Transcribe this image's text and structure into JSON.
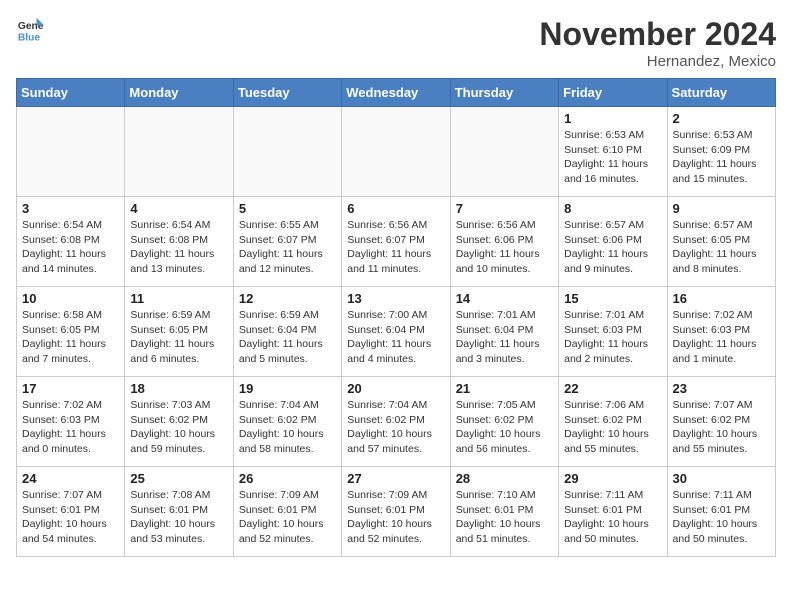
{
  "header": {
    "logo_general": "General",
    "logo_blue": "Blue",
    "month": "November 2024",
    "location": "Hernandez, Mexico"
  },
  "weekdays": [
    "Sunday",
    "Monday",
    "Tuesday",
    "Wednesday",
    "Thursday",
    "Friday",
    "Saturday"
  ],
  "weeks": [
    [
      {
        "day": "",
        "info": "",
        "empty": true
      },
      {
        "day": "",
        "info": "",
        "empty": true
      },
      {
        "day": "",
        "info": "",
        "empty": true
      },
      {
        "day": "",
        "info": "",
        "empty": true
      },
      {
        "day": "",
        "info": "",
        "empty": true
      },
      {
        "day": "1",
        "info": "Sunrise: 6:53 AM\nSunset: 6:10 PM\nDaylight: 11 hours\nand 16 minutes."
      },
      {
        "day": "2",
        "info": "Sunrise: 6:53 AM\nSunset: 6:09 PM\nDaylight: 11 hours\nand 15 minutes."
      }
    ],
    [
      {
        "day": "3",
        "info": "Sunrise: 6:54 AM\nSunset: 6:08 PM\nDaylight: 11 hours\nand 14 minutes."
      },
      {
        "day": "4",
        "info": "Sunrise: 6:54 AM\nSunset: 6:08 PM\nDaylight: 11 hours\nand 13 minutes."
      },
      {
        "day": "5",
        "info": "Sunrise: 6:55 AM\nSunset: 6:07 PM\nDaylight: 11 hours\nand 12 minutes."
      },
      {
        "day": "6",
        "info": "Sunrise: 6:56 AM\nSunset: 6:07 PM\nDaylight: 11 hours\nand 11 minutes."
      },
      {
        "day": "7",
        "info": "Sunrise: 6:56 AM\nSunset: 6:06 PM\nDaylight: 11 hours\nand 10 minutes."
      },
      {
        "day": "8",
        "info": "Sunrise: 6:57 AM\nSunset: 6:06 PM\nDaylight: 11 hours\nand 9 minutes."
      },
      {
        "day": "9",
        "info": "Sunrise: 6:57 AM\nSunset: 6:05 PM\nDaylight: 11 hours\nand 8 minutes."
      }
    ],
    [
      {
        "day": "10",
        "info": "Sunrise: 6:58 AM\nSunset: 6:05 PM\nDaylight: 11 hours\nand 7 minutes."
      },
      {
        "day": "11",
        "info": "Sunrise: 6:59 AM\nSunset: 6:05 PM\nDaylight: 11 hours\nand 6 minutes."
      },
      {
        "day": "12",
        "info": "Sunrise: 6:59 AM\nSunset: 6:04 PM\nDaylight: 11 hours\nand 5 minutes."
      },
      {
        "day": "13",
        "info": "Sunrise: 7:00 AM\nSunset: 6:04 PM\nDaylight: 11 hours\nand 4 minutes."
      },
      {
        "day": "14",
        "info": "Sunrise: 7:01 AM\nSunset: 6:04 PM\nDaylight: 11 hours\nand 3 minutes."
      },
      {
        "day": "15",
        "info": "Sunrise: 7:01 AM\nSunset: 6:03 PM\nDaylight: 11 hours\nand 2 minutes."
      },
      {
        "day": "16",
        "info": "Sunrise: 7:02 AM\nSunset: 6:03 PM\nDaylight: 11 hours\nand 1 minute."
      }
    ],
    [
      {
        "day": "17",
        "info": "Sunrise: 7:02 AM\nSunset: 6:03 PM\nDaylight: 11 hours\nand 0 minutes."
      },
      {
        "day": "18",
        "info": "Sunrise: 7:03 AM\nSunset: 6:02 PM\nDaylight: 10 hours\nand 59 minutes."
      },
      {
        "day": "19",
        "info": "Sunrise: 7:04 AM\nSunset: 6:02 PM\nDaylight: 10 hours\nand 58 minutes."
      },
      {
        "day": "20",
        "info": "Sunrise: 7:04 AM\nSunset: 6:02 PM\nDaylight: 10 hours\nand 57 minutes."
      },
      {
        "day": "21",
        "info": "Sunrise: 7:05 AM\nSunset: 6:02 PM\nDaylight: 10 hours\nand 56 minutes."
      },
      {
        "day": "22",
        "info": "Sunrise: 7:06 AM\nSunset: 6:02 PM\nDaylight: 10 hours\nand 55 minutes."
      },
      {
        "day": "23",
        "info": "Sunrise: 7:07 AM\nSunset: 6:02 PM\nDaylight: 10 hours\nand 55 minutes."
      }
    ],
    [
      {
        "day": "24",
        "info": "Sunrise: 7:07 AM\nSunset: 6:01 PM\nDaylight: 10 hours\nand 54 minutes."
      },
      {
        "day": "25",
        "info": "Sunrise: 7:08 AM\nSunset: 6:01 PM\nDaylight: 10 hours\nand 53 minutes."
      },
      {
        "day": "26",
        "info": "Sunrise: 7:09 AM\nSunset: 6:01 PM\nDaylight: 10 hours\nand 52 minutes."
      },
      {
        "day": "27",
        "info": "Sunrise: 7:09 AM\nSunset: 6:01 PM\nDaylight: 10 hours\nand 52 minutes."
      },
      {
        "day": "28",
        "info": "Sunrise: 7:10 AM\nSunset: 6:01 PM\nDaylight: 10 hours\nand 51 minutes."
      },
      {
        "day": "29",
        "info": "Sunrise: 7:11 AM\nSunset: 6:01 PM\nDaylight: 10 hours\nand 50 minutes."
      },
      {
        "day": "30",
        "info": "Sunrise: 7:11 AM\nSunset: 6:01 PM\nDaylight: 10 hours\nand 50 minutes."
      }
    ]
  ]
}
